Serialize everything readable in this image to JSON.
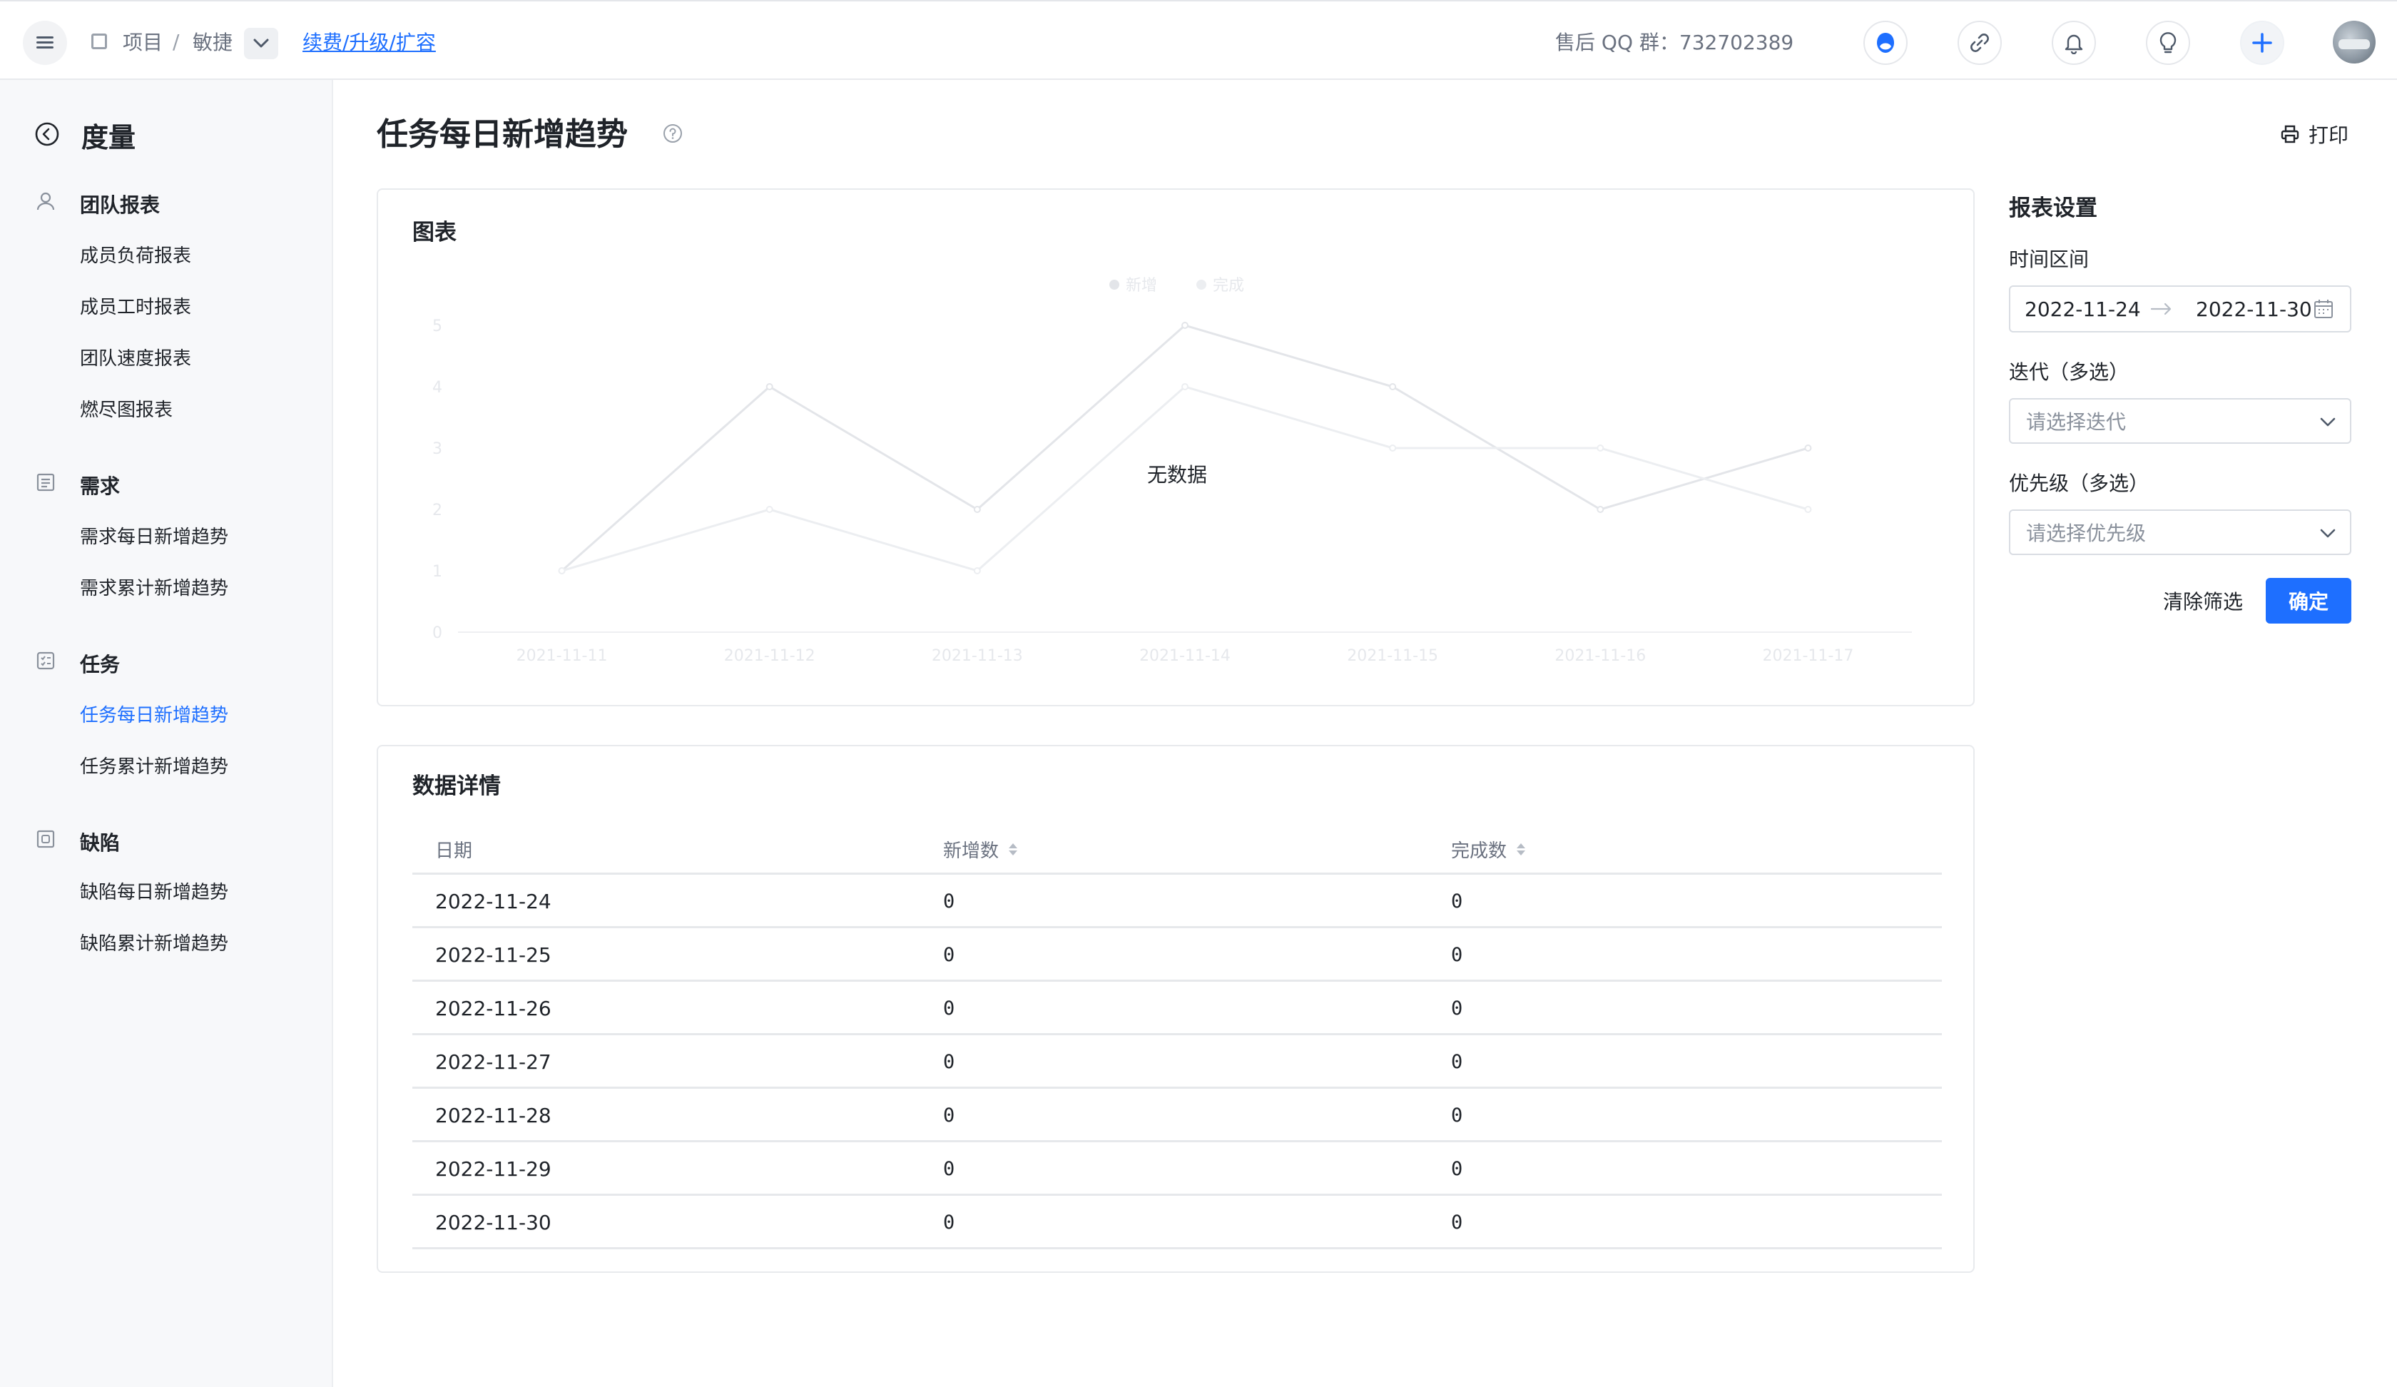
{
  "topbar": {
    "breadcrumb_project": "项目",
    "breadcrumb_sep": "/",
    "breadcrumb_agile": "敏捷",
    "renew_link": "续费/升级/扩容",
    "qq_group": "售后 QQ 群：732702389",
    "icons": [
      "menu-icon",
      "brand-icon",
      "link-icon",
      "bell-icon",
      "bulb-icon",
      "plus-icon"
    ]
  },
  "sidebar": {
    "title": "度量",
    "sections": [
      {
        "label": "团队报表",
        "icon": "user-icon",
        "items": [
          "成员负荷报表",
          "成员工时报表",
          "团队速度报表",
          "燃尽图报表"
        ]
      },
      {
        "label": "需求",
        "icon": "document-icon",
        "items": [
          "需求每日新增趋势",
          "需求累计新增趋势"
        ]
      },
      {
        "label": "任务",
        "icon": "task-icon",
        "items": [
          "任务每日新增趋势",
          "任务累计新增趋势"
        ]
      },
      {
        "label": "缺陷",
        "icon": "bug-icon",
        "items": [
          "缺陷每日新增趋势",
          "缺陷累计新增趋势"
        ]
      }
    ],
    "active_item": "任务每日新增趋势"
  },
  "main": {
    "title": "任务每日新增趋势",
    "print_label": "打印",
    "chart_card_title": "图表",
    "no_data_text": "无数据",
    "detail_card_title": "数据详情"
  },
  "chart_data": {
    "type": "line",
    "categories": [
      "2021-11-11",
      "2021-11-12",
      "2021-11-13",
      "2021-11-14",
      "2021-11-15",
      "2021-11-16",
      "2021-11-17"
    ],
    "series": [
      {
        "name": "新增",
        "values": [
          1,
          4,
          2,
          5,
          4,
          2,
          3
        ]
      },
      {
        "name": "完成",
        "values": [
          1,
          2,
          1,
          4,
          3,
          3,
          2
        ]
      }
    ],
    "yticks": [
      "0",
      "1",
      "2",
      "3",
      "4",
      "5"
    ],
    "ylim": [
      0,
      5
    ],
    "legend_position": "top-center",
    "grid": false,
    "placeholder_faded": true
  },
  "table": {
    "columns": [
      "日期",
      "新增数",
      "完成数"
    ],
    "rows": [
      [
        "2022-11-24",
        "0",
        "0"
      ],
      [
        "2022-11-25",
        "0",
        "0"
      ],
      [
        "2022-11-26",
        "0",
        "0"
      ],
      [
        "2022-11-27",
        "0",
        "0"
      ],
      [
        "2022-11-28",
        "0",
        "0"
      ],
      [
        "2022-11-29",
        "0",
        "0"
      ],
      [
        "2022-11-30",
        "0",
        "0"
      ]
    ]
  },
  "settings": {
    "title": "报表设置",
    "time_range_label": "时间区间",
    "start_date": "2022-11-24",
    "end_date": "2022-11-30",
    "iteration_label": "迭代（多选）",
    "iteration_placeholder": "请选择迭代",
    "priority_label": "优先级（多选）",
    "priority_placeholder": "请选择优先级",
    "clear_label": "清除筛选",
    "confirm_label": "确定"
  },
  "colors": {
    "accent": "#1e6fff",
    "text": "#1f2329",
    "sidebar_bg": "#f7f8fa"
  }
}
